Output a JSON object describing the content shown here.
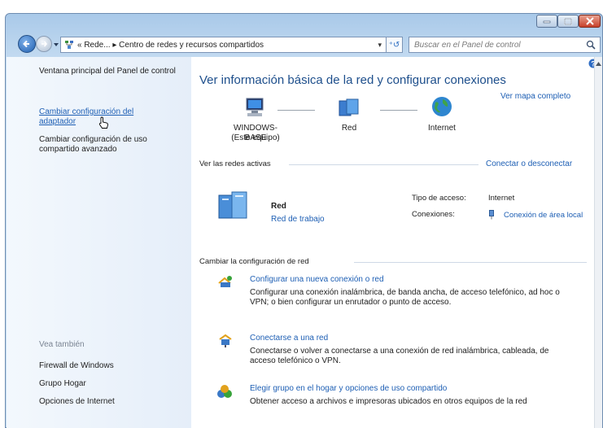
{
  "window": {
    "controls": {
      "minimize": "minimize-icon",
      "maximize": "maximize-icon",
      "close": "close-icon"
    }
  },
  "address": {
    "breadcrumb": "« Rede... ▸ Centro de redes y recursos compartidos",
    "search_placeholder": "Buscar en el Panel de control"
  },
  "sidebar": {
    "main_link": "Ventana principal del Panel de control",
    "links": [
      "Cambiar configuración del adaptador",
      "Cambiar configuración de uso compartido avanzado"
    ],
    "see_also_heading": "Vea también",
    "see_also": [
      "Firewall de Windows",
      "Grupo Hogar",
      "Opciones de Internet"
    ]
  },
  "main": {
    "title": "Ver información básica de la red y configurar conexiones",
    "full_map_link": "Ver mapa completo",
    "map": {
      "computer_name": "WINDOWS-BASE",
      "computer_sub": "(Este equipo)",
      "network": "Red",
      "internet": "Internet"
    },
    "active_networks_heading": "Ver las redes activas",
    "connect_link": "Conectar o desconectar",
    "active_network": {
      "name": "Red",
      "type_link": "Red de trabajo",
      "access_label": "Tipo de acceso:",
      "access_value": "Internet",
      "connections_label": "Conexiones:",
      "connection_link": "Conexión de área local"
    },
    "change_heading": "Cambiar la configuración de red",
    "tasks": [
      {
        "title": "Configurar una nueva conexión o red",
        "desc": "Configurar una conexión inalámbrica, de banda ancha, de acceso telefónico, ad hoc o VPN; o bien configurar un enrutador o punto de acceso."
      },
      {
        "title": "Conectarse a una red",
        "desc": "Conectarse o volver a conectarse a una conexión de red inalámbrica, cableada, de acceso telefónico o VPN."
      },
      {
        "title": "Elegir grupo en el hogar y opciones de uso compartido",
        "desc": "Obtener acceso a archivos e impresoras ubicados en otros equipos de la red"
      }
    ]
  }
}
